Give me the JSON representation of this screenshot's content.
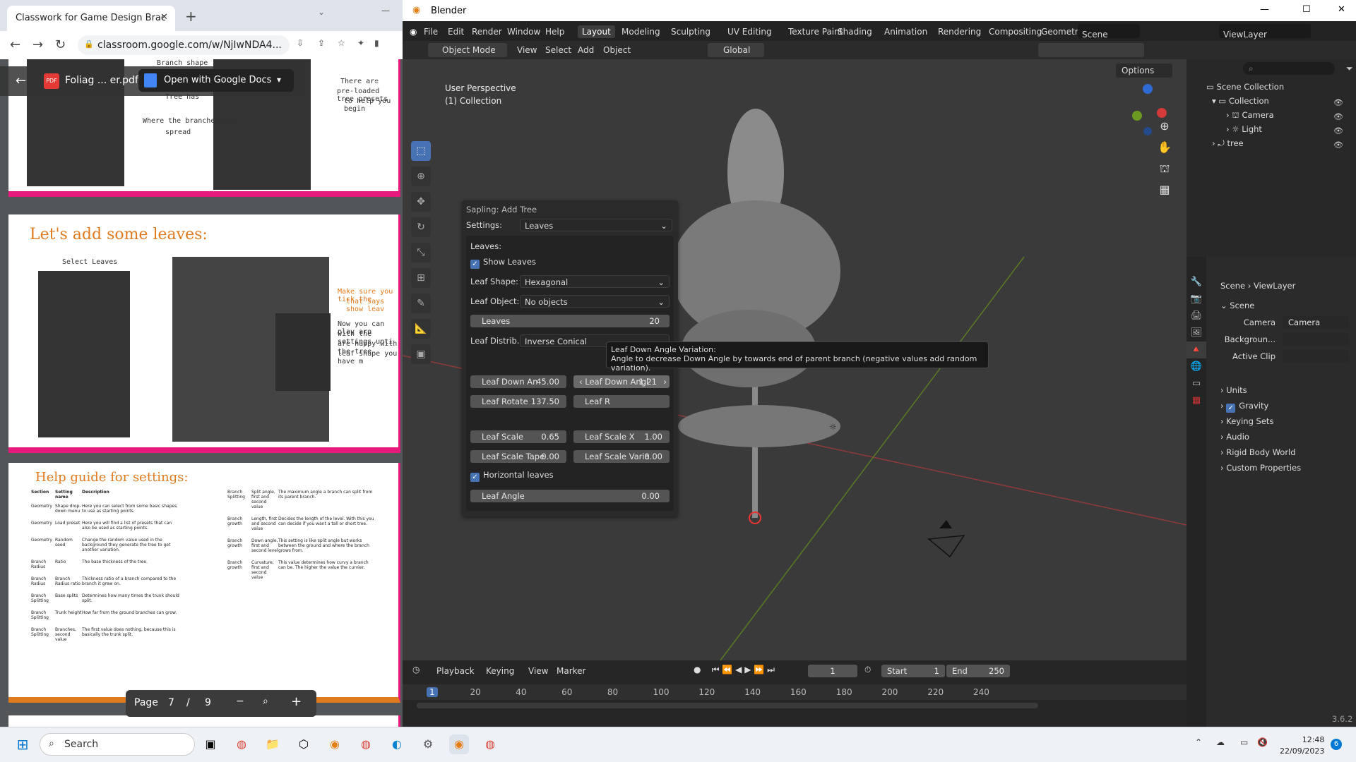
{
  "chrome": {
    "tab_title": "Classwork for Game Design Brac",
    "address": "classroom.google.com/w/NjIwNDA4...",
    "pdf_name": "Foliag ... er.pdf",
    "open_with": "Open with Google Docs",
    "pdf_badge": "PDF",
    "slide2_title": "Let's add some leaves:",
    "slide2_note_select": "Select Leaves",
    "slide2_note_tick": "Make sure you tick the",
    "slide2_note_tick2": "that says show leav",
    "slide2_note_play": "Now you can play aro",
    "slide2_note_play2": "with the settings unti",
    "slide2_note_play3": "are happy with the tree",
    "slide2_note_play4": "leaf shape you have m",
    "slide1_notes": [
      "Branch shape",
      "Tree has",
      "Where the branches are",
      "spread",
      "There are",
      "pre-loaded tree presets",
      "to help you begin"
    ],
    "slide3_title": "Help guide for settings:",
    "guide_headers": [
      "Section",
      "Setting name",
      "Description"
    ],
    "guide_left": [
      [
        "Geometry",
        "Shape drop-down menu",
        "Here you can select from some basic shapes to use as starting points."
      ],
      [
        "Geometry",
        "Load preset",
        "Here you will find a list of presets that can also be used as starting points."
      ],
      [
        "Geometry",
        "Random seed",
        "Change the random value used in the background they generate the tree to get another variation."
      ],
      [
        "Branch Radius",
        "Ratio",
        "The base thickness of the tree."
      ],
      [
        "Branch Radius",
        "Branch Radius ratio",
        "Thickness ratio of a branch compared to the branch it grew on."
      ],
      [
        "Branch Splitting",
        "Base splits",
        "Determines how many times the trunk should split."
      ],
      [
        "Branch Splitting",
        "Trunk height",
        "How far from the ground branches can grow."
      ],
      [
        "Branch Splitting",
        "Branches, second value",
        "The first value does nothing, because this is basically the trunk split."
      ]
    ],
    "guide_right": [
      [
        "Branch Splitting",
        "Split angle, first and second value",
        "The maximum angle a branch can split from its parent branch."
      ],
      [
        "Branch growth",
        "Length, first and second value",
        "Decides the length of the level. With this you can decide if you want a tall or short tree."
      ],
      [
        "Branch growth",
        "Down angle, first and second level",
        "This setting is like split angle but works between the ground and where the branch grows from."
      ],
      [
        "Branch growth",
        "Curvature, first and second value",
        "This value determines how curvy a branch can be. The higher the value the curvier."
      ]
    ],
    "page_label": "Page",
    "page_current": "7",
    "page_sep": "/",
    "page_total": "9"
  },
  "blender": {
    "window_title": "Blender",
    "menus": [
      "File",
      "Edit",
      "Render",
      "Window",
      "Help"
    ],
    "workspaces": [
      "Layout",
      "Modeling",
      "Sculpting",
      "UV Editing",
      "Texture Paint",
      "Shading",
      "Animation",
      "Rendering",
      "Compositing",
      "Geometry N"
    ],
    "scene": "Scene",
    "viewlayer": "ViewLayer",
    "mode": "Object Mode",
    "header_menus": [
      "View",
      "Select",
      "Add",
      "Object"
    ],
    "transform": "Global",
    "options": "Options",
    "viewport_info1": "User Perspective",
    "viewport_info2": "(1) Collection",
    "panel": {
      "title": "Sapling: Add Tree",
      "settings_label": "Settings:",
      "settings_value": "Leaves",
      "section": "Leaves:",
      "show_leaves": "Show Leaves",
      "leaf_shape_label": "Leaf Shape:",
      "leaf_shape": "Hexagonal",
      "leaf_object_label": "Leaf Object:",
      "leaf_object": "No objects",
      "leaves_label": "Leaves",
      "leaves_value": "20",
      "leaf_distrib_label": "Leaf Distrib...",
      "leaf_distrib": "Inverse Conical",
      "down_an_label": "Leaf Down An",
      "down_an_value": "45.00",
      "down_angl_label": "Leaf Down Angl",
      "down_angl_value": "1.21",
      "rotate_label": "Leaf Rotate",
      "rotate_value": "137.50",
      "leaf_r_label": "Leaf R",
      "scale_label": "Leaf Scale",
      "scale_value": "0.65",
      "scale_x_label": "Leaf Scale X",
      "scale_x_value": "1.00",
      "scale_tape_label": "Leaf Scale Tape",
      "scale_tape_value": "0.00",
      "scale_varia_label": "Leaf Scale Varia",
      "scale_varia_value": "0.00",
      "horizontal": "Horizontal leaves",
      "angle_label": "Leaf Angle",
      "angle_value": "0.00"
    },
    "tooltip_title": "Leaf Down Angle Variation:",
    "tooltip_body": "Angle to decrease Down Angle by towards end of parent branch (negative values add random variation).",
    "timeline": {
      "menus": [
        "Playback",
        "Keying",
        "View",
        "Marker"
      ],
      "current": "1",
      "start_label": "Start",
      "start": "1",
      "end_label": "End",
      "end": "250",
      "ticks": [
        "1",
        "20",
        "40",
        "60",
        "80",
        "100",
        "120",
        "140",
        "160",
        "180",
        "200",
        "220",
        "240"
      ]
    },
    "outliner": {
      "root": "Scene Collection",
      "collection": "Collection",
      "items": [
        "Camera",
        "Light",
        "tree"
      ]
    },
    "properties": {
      "breadcrumb1": "Scene",
      "breadcrumb2": "ViewLayer",
      "section": "Scene",
      "camera_label": "Camera",
      "camera_value": "Camera",
      "background_label": "Backgroun...",
      "active_clip_label": "Active Clip",
      "panels": [
        "Units",
        "Gravity",
        "Keying Sets",
        "Audio",
        "Rigid Body World",
        "Custom Properties"
      ]
    },
    "version": "3.6.2"
  },
  "taskbar": {
    "search": "Search",
    "time": "12:48",
    "date": "22/09/2023",
    "notif_count": "6"
  },
  "colors": {
    "accent": "#4772b3",
    "pdf_orange": "#e07a1f",
    "pdf_pink": "#e8197d",
    "axis_red": "#a33",
    "axis_green": "#6a9a1f"
  }
}
